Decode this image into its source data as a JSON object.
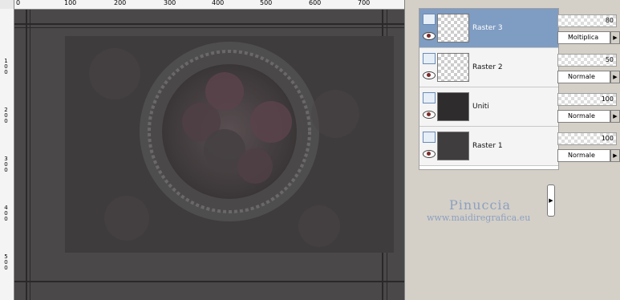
{
  "ruler_top": {
    "labels": [
      "0",
      "100",
      "200",
      "300",
      "400",
      "500",
      "600",
      "700"
    ]
  },
  "ruler_left": {
    "labels": [
      "1\n0\n0",
      "2\n0\n0",
      "3\n0\n0",
      "4\n0\n0",
      "5\n0\n0"
    ]
  },
  "layers": [
    {
      "name": "Raster 3",
      "selected": true
    },
    {
      "name": "Raster 2",
      "selected": false
    },
    {
      "name": "Uniti",
      "selected": false
    },
    {
      "name": "Raster 1",
      "selected": false
    }
  ],
  "layer_props": [
    {
      "opacity": "80",
      "blend": "Moltiplica"
    },
    {
      "opacity": "50",
      "blend": "Normale"
    },
    {
      "opacity": "100",
      "blend": "Normale"
    },
    {
      "opacity": "100",
      "blend": "Normale"
    }
  ],
  "watermark": {
    "name": "Pinuccia",
    "url": "www.maidiregrafica.eu"
  },
  "colors": {
    "selected_row": "#7f9cc2",
    "watermark": "#8ea0bf"
  }
}
